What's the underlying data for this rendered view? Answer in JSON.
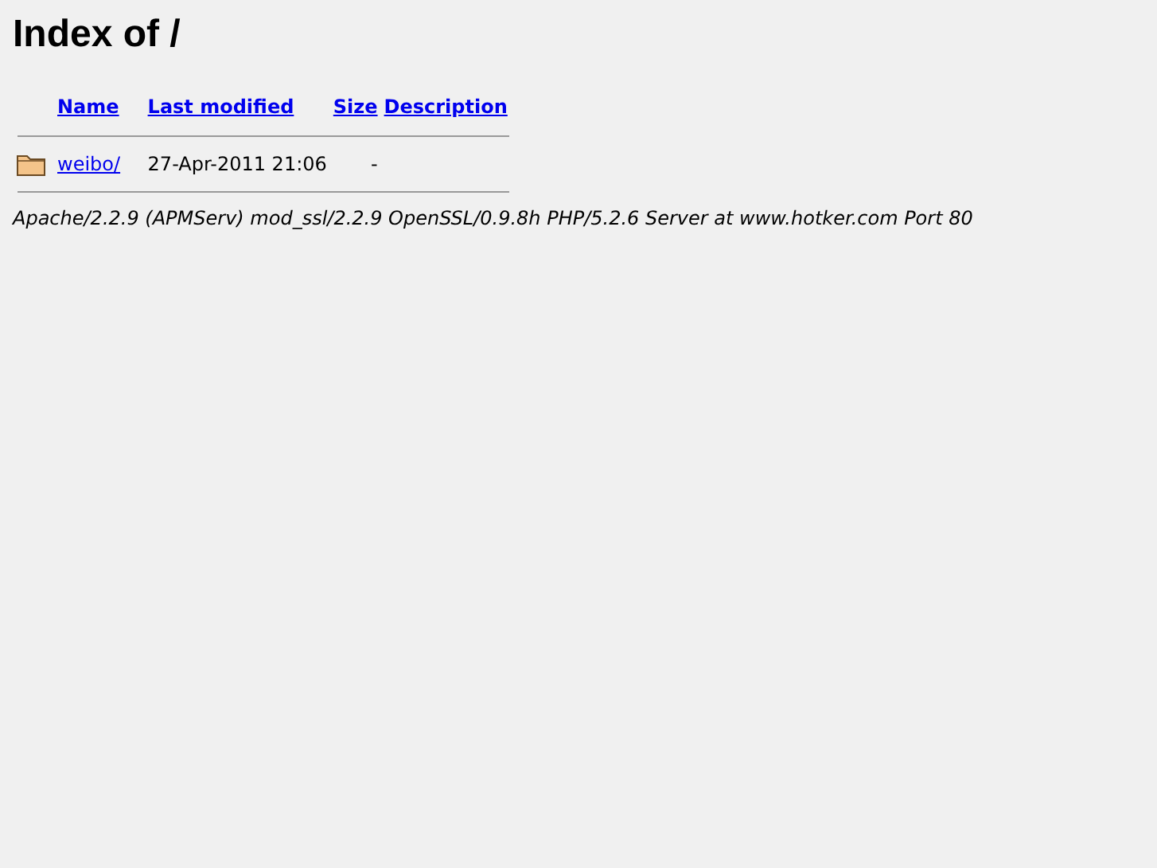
{
  "title": "Index of /",
  "table": {
    "columns": [
      "Name",
      "Last modified",
      "Size",
      "Description"
    ],
    "rows": [
      {
        "kind": "folder",
        "name": "weibo/",
        "last_modified": "27-Apr-2011 21:06",
        "size": "-"
      }
    ]
  },
  "address": "Apache/2.2.9 (APMServ) mod_ssl/2.2.9 OpenSSL/0.9.8h PHP/5.2.6 Server at www.hotker.com Port 80"
}
